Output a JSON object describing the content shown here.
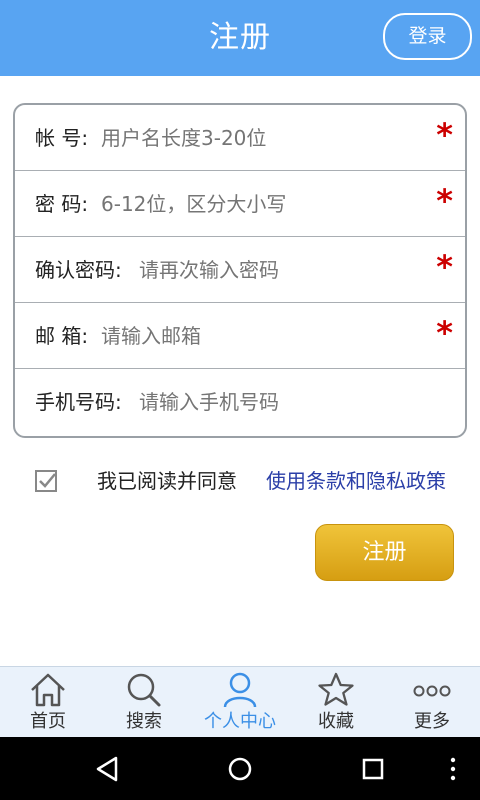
{
  "header": {
    "title": "注册",
    "login_label": "登录"
  },
  "form": {
    "fields": [
      {
        "label": "帐 号:",
        "placeholder": "用户名长度3-20位",
        "required": true,
        "required_mark": "*"
      },
      {
        "label": "密 码:",
        "placeholder": "6-12位，区分大小写",
        "required": true,
        "required_mark": "*"
      },
      {
        "label": "确认密码:",
        "placeholder": "请再次输入密码",
        "required": true,
        "required_mark": "*"
      },
      {
        "label": "邮 箱:",
        "placeholder": "请输入邮箱",
        "required": true,
        "required_mark": "*"
      },
      {
        "label": "手机号码:",
        "placeholder": "请输入手机号码",
        "required": false
      }
    ]
  },
  "agreement": {
    "checked": true,
    "text": "我已阅读并同意",
    "link": "使用条款和隐私政策"
  },
  "submit": {
    "label": "注册"
  },
  "bottom_nav": {
    "items": [
      {
        "label": "首页",
        "icon": "home-icon",
        "active": false
      },
      {
        "label": "搜索",
        "icon": "search-icon",
        "active": false
      },
      {
        "label": "个人中心",
        "icon": "user-icon",
        "active": true
      },
      {
        "label": "收藏",
        "icon": "star-icon",
        "active": false
      },
      {
        "label": "更多",
        "icon": "more-icon",
        "active": false
      }
    ]
  },
  "system_nav": {
    "icons": [
      "back-icon",
      "home-circle-icon",
      "recents-icon",
      "overflow-icon"
    ]
  },
  "colors": {
    "header": "#58a4f2",
    "required": "#cc0000",
    "link": "#2b3fa8",
    "button": "#e0aa1c",
    "nav_active": "#3b8fe6"
  }
}
